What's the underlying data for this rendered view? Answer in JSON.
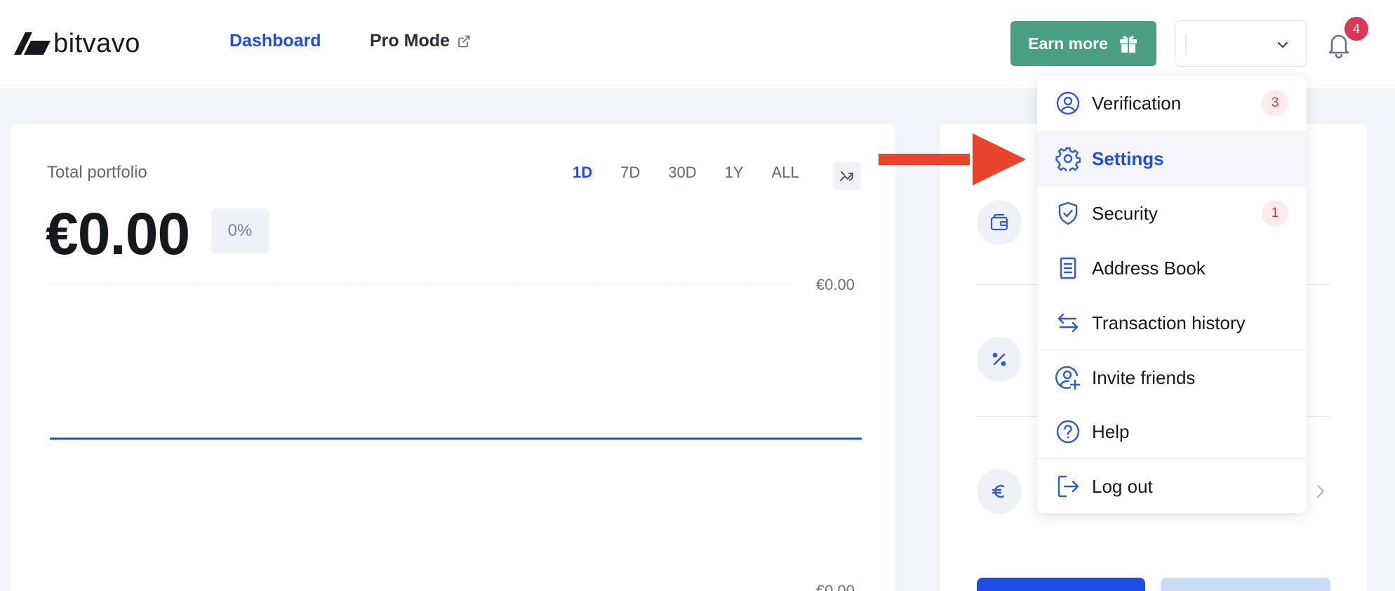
{
  "header": {
    "logo_text": "bitvavo",
    "nav_dashboard": "Dashboard",
    "nav_pro_mode": "Pro Mode",
    "earn_more": "Earn more",
    "notifications_count": "4"
  },
  "portfolio": {
    "label": "Total portfolio",
    "value": "€0.00",
    "change": "0%",
    "ranges": [
      "1D",
      "7D",
      "30D",
      "1Y",
      "ALL"
    ],
    "active_range": "1D"
  },
  "chart_data": {
    "type": "line",
    "x": [
      0,
      1
    ],
    "series": [
      {
        "values": [
          0,
          0
        ]
      }
    ],
    "y_tick_labels": [
      "€0.00",
      "€0.00"
    ],
    "color": "#1f4ee6",
    "grid": true,
    "legend": "none"
  },
  "menu": {
    "items": [
      {
        "label": "Verification",
        "badge": "3",
        "icon": "user-circle-icon"
      },
      {
        "label": "Settings",
        "badge": "",
        "icon": "gear-icon",
        "active": true
      },
      {
        "label": "Security",
        "badge": "1",
        "icon": "shield-check-icon"
      },
      {
        "label": "Address Book",
        "badge": "",
        "icon": "document-list-icon"
      },
      {
        "label": "Transaction history",
        "badge": "",
        "icon": "arrows-swap-icon"
      },
      {
        "label": "Invite friends",
        "badge": "",
        "icon": "user-plus-icon"
      },
      {
        "label": "Help",
        "badge": "",
        "icon": "question-circle-icon"
      },
      {
        "label": "Log out",
        "badge": "",
        "icon": "logout-icon"
      }
    ]
  },
  "right_card": {
    "icons": [
      "wallet-icon",
      "percent-icon",
      "euro-icon"
    ]
  },
  "colors": {
    "accent": "#1f4ee6",
    "earn": "#4a9e84",
    "badge": "#d93a53",
    "annotation_arrow": "#e8432b"
  }
}
